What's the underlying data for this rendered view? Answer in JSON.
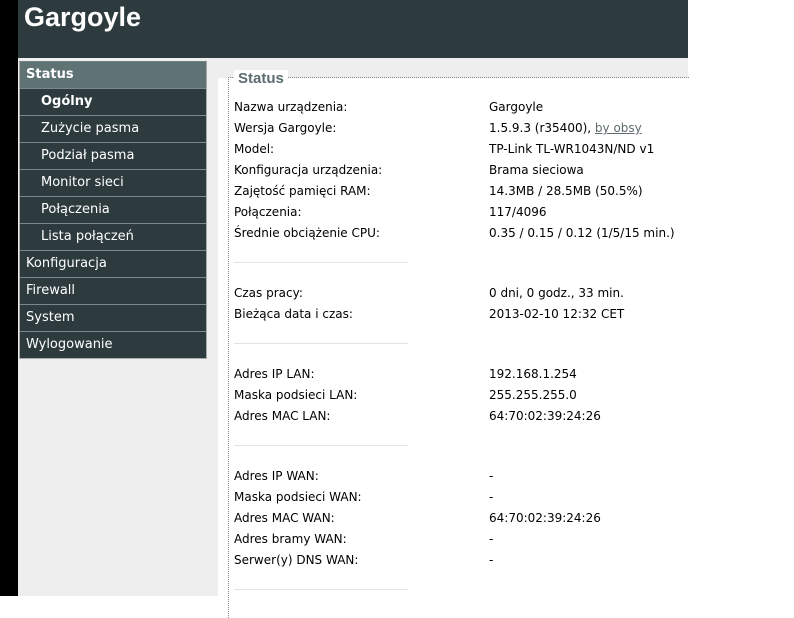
{
  "app": {
    "title": "Gargoyle"
  },
  "sidebar": {
    "items": [
      {
        "label": "Status",
        "level": 0,
        "active": true
      },
      {
        "label": "Ogólny",
        "level": 1,
        "current": true
      },
      {
        "label": "Zużycie pasma",
        "level": 1
      },
      {
        "label": "Podział pasma",
        "level": 1
      },
      {
        "label": "Monitor sieci",
        "level": 1
      },
      {
        "label": "Połączenia",
        "level": 1
      },
      {
        "label": "Lista połączeń",
        "level": 1
      },
      {
        "label": "Konfiguracja",
        "level": 0
      },
      {
        "label": "Firewall",
        "level": 0
      },
      {
        "label": "System",
        "level": 0
      },
      {
        "label": "Wylogowanie",
        "level": 0
      }
    ]
  },
  "status": {
    "legend": "Status",
    "device": {
      "name_label": "Nazwa urządzenia:",
      "name_value": "Gargoyle",
      "version_label": "Wersja Gargoyle:",
      "version_value": "1.5.9.3 (r35400), ",
      "version_link": "by obsy",
      "model_label": "Model:",
      "model_value": "TP-Link TL-WR1043N/ND v1",
      "config_label": "Konfiguracja urządzenia:",
      "config_value": "Brama sieciowa",
      "ram_label": "Zajętość pamięci RAM:",
      "ram_value": "14.3MB / 28.5MB (50.5%)",
      "conn_label": "Połączenia:",
      "conn_value": "117/4096",
      "cpu_label": "Średnie obciążenie CPU:",
      "cpu_value": "0.35 / 0.15 / 0.12  (1/5/15 min.)"
    },
    "time": {
      "uptime_label": "Czas pracy:",
      "uptime_value": "0 dni, 0 godz., 33 min.",
      "date_label": "Bieżąca data i czas:",
      "date_value": "2013-02-10 12:32 CET"
    },
    "lan": {
      "ip_label": "Adres IP LAN:",
      "ip_value": "192.168.1.254",
      "mask_label": "Maska podsieci LAN:",
      "mask_value": "255.255.255.0",
      "mac_label": "Adres MAC LAN:",
      "mac_value": "64:70:02:39:24:26"
    },
    "wan": {
      "ip_label": "Adres IP WAN:",
      "ip_value": "-",
      "mask_label": "Maska podsieci WAN:",
      "mask_value": "-",
      "mac_label": "Adres MAC WAN:",
      "mac_value": "64:70:02:39:24:26",
      "gw_label": "Adres bramy WAN:",
      "gw_value": "-",
      "dns_label": "Serwer(y) DNS WAN:",
      "dns_value": "-"
    }
  }
}
